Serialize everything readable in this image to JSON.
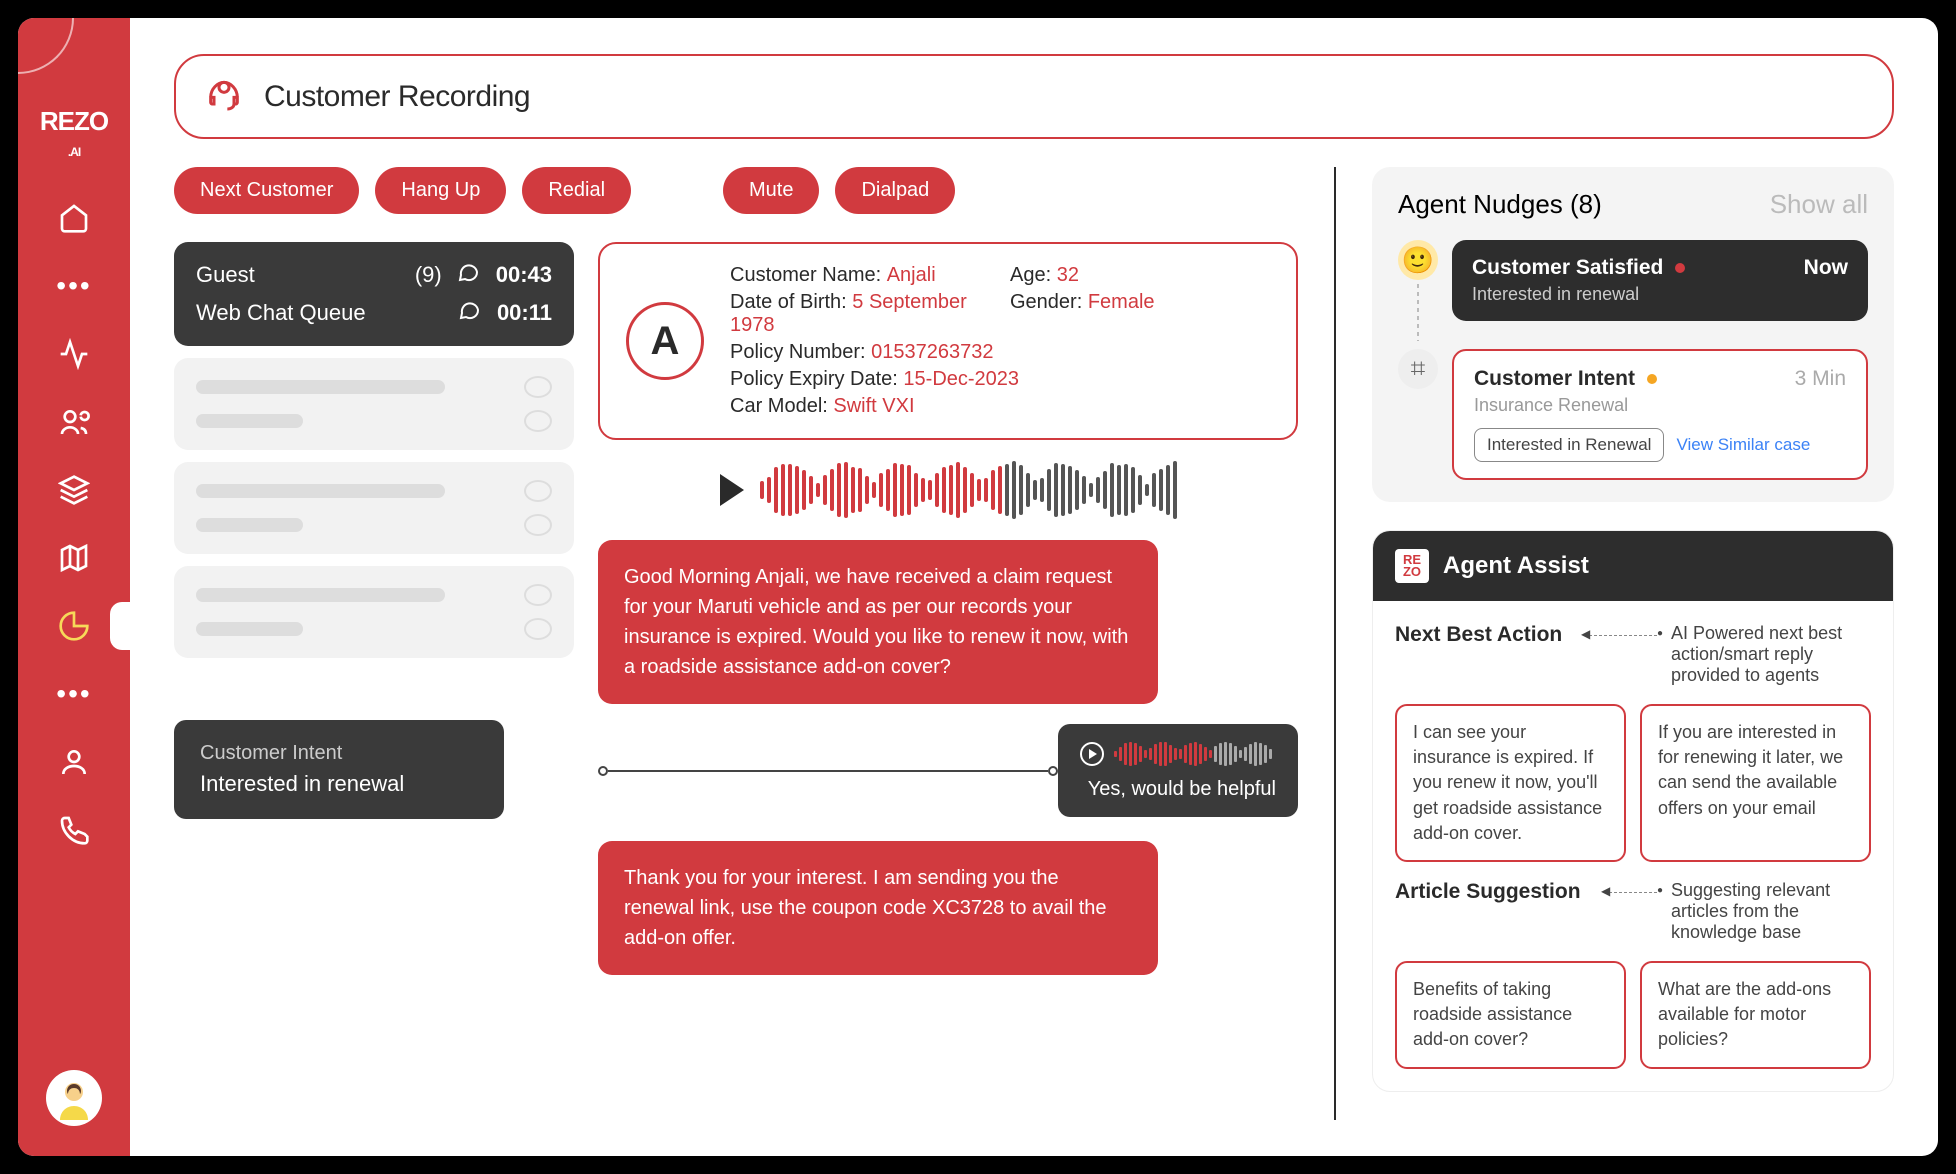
{
  "brand": "REZO",
  "brand_sub": ".AI",
  "header_title": "Customer Recording",
  "buttons": {
    "next_customer": "Next Customer",
    "hang_up": "Hang Up",
    "redial": "Redial",
    "mute": "Mute",
    "dialpad": "Dialpad"
  },
  "queue": {
    "title": "Guest",
    "count": "(9)",
    "time1": "00:43",
    "subtitle": "Web Chat Queue",
    "time2": "00:11"
  },
  "intent_box": {
    "label": "Customer Intent",
    "value": "Interested in renewal"
  },
  "customer": {
    "initial": "A",
    "name_label": "Customer Name:",
    "name": "Anjali",
    "age_label": "Age:",
    "age": "32",
    "dob_label": "Date of Birth:",
    "dob": "5 September 1978",
    "gender_label": "Gender:",
    "gender": "Female",
    "policy_label": "Policy Number:",
    "policy": "01537263732",
    "expiry_label": "Policy Expiry Date:",
    "expiry": "15-Dec-2023",
    "car_label": "Car Model:",
    "car": "Swift VXI"
  },
  "agent_msg1": "Good Morning Anjali, we have received a claim request for your Maruti vehicle and as per our records your insurance is expired. Would you like to renew it now, with a roadside assistance add-on cover?",
  "cust_reply": "Yes,  would be helpful",
  "agent_msg2": "Thank you for your interest. I am sending you the renewal link, use the coupon code XC3728 to avail the add-on offer.",
  "nudges": {
    "title": "Agent Nudges (8)",
    "showall": "Show all",
    "satisfied": {
      "title": "Customer Satisfied",
      "time": "Now",
      "sub": "Interested in renewal"
    },
    "intent": {
      "title": "Customer Intent",
      "time": "3 Min",
      "sub": "Insurance Renewal",
      "badge": "Interested in Renewal",
      "link": "View Similar case"
    }
  },
  "assist": {
    "title": "Agent Assist",
    "nba_label": "Next Best Action",
    "nba_desc": "AI Powered next best action/smart reply provided to agents",
    "nba_cards": [
      "I can see your insurance is expired. If you renew it now, you'll get roadside assistance add-on cover.",
      "If you are interested in for renewing it later, we can send the available offers on your email"
    ],
    "art_label": "Article Suggestion",
    "art_desc": "Suggesting relevant articles from the knowledge base",
    "art_cards": [
      "Benefits of taking roadside assistance add-on cover?",
      "What are the add-ons available for motor policies?"
    ]
  }
}
